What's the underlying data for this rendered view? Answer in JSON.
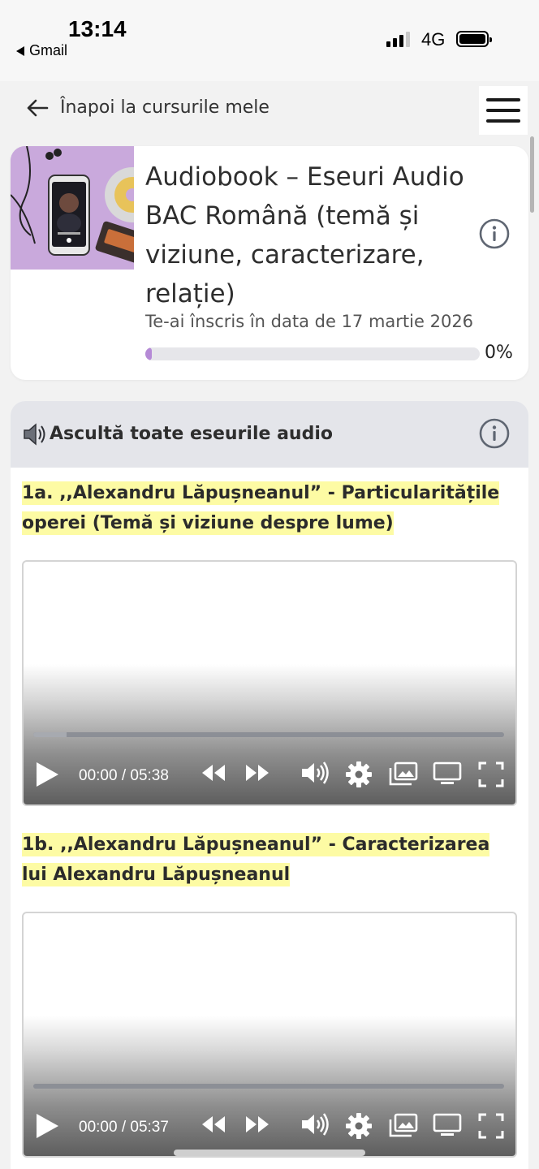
{
  "status_bar": {
    "time": "13:14",
    "back_app": "Gmail",
    "network": "4G"
  },
  "nav": {
    "back_label": "Înapoi la cursurile mele"
  },
  "course": {
    "title": "Audiobook – Eseuri Audio BAC Română (temă și viziune, caracterizare, relație)",
    "enrolled_text": "Te-ai înscris în data de 17 martie 2026",
    "progress_text": "0%",
    "progress_value": 0.02
  },
  "section": {
    "title": "Ascultă toate eseurile audio"
  },
  "lessons": [
    {
      "title": ",,Alexandru Lăpușneanul” - Particularitățile operei (Temă și viziune despre lume)",
      "number": "1a.",
      "time_display": "00:00 / 05:38",
      "buffered": 0.07
    },
    {
      "title": ",,Alexandru Lăpușneanul” - Caracterizarea lui Alexandru Lăpușneanul",
      "number": "1b.",
      "time_display": "00:00 / 05:37",
      "buffered": 0.0
    }
  ],
  "colors": {
    "highlight": "#fdfba4",
    "progress_accent": "#b58ad6",
    "section_header_bg": "#e4e5ea"
  }
}
